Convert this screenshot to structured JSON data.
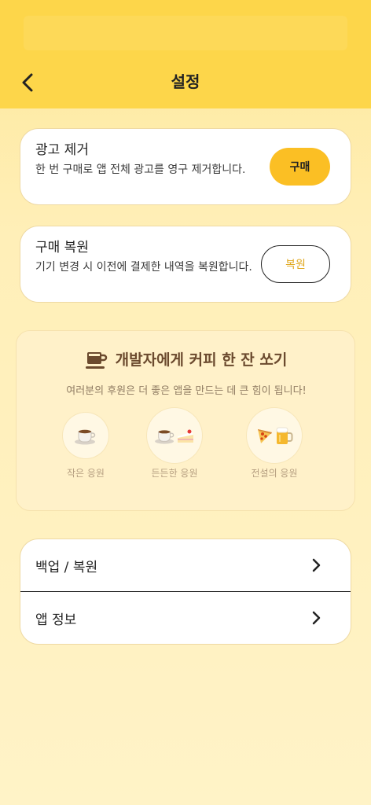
{
  "header": {
    "title": "설정",
    "back_icon": "chevron-left-icon"
  },
  "remove_ads": {
    "title": "광고 제거",
    "description": "한 번 구매로 앱 전체 광고를 영구 제거합니다.",
    "button_label": "구매"
  },
  "restore_purchase": {
    "title": "구매 복원",
    "description": "기기 변경 시 이전에 결제한 내역을 복원합니다.",
    "button_label": "복원"
  },
  "coffee": {
    "title": "개발자에게 커피 한 잔 쏘기",
    "subtitle": "여러분의 후원은 더 좋은 앱을 만드는 데 큰 힘이 됩니다!",
    "icon": "coffee-cup-icon",
    "tiers": [
      {
        "label": "작은 응원",
        "icons": [
          "coffee-icon"
        ]
      },
      {
        "label": "든든한 응원",
        "icons": [
          "coffee-icon",
          "cake-icon"
        ]
      },
      {
        "label": "전설의 응원",
        "icons": [
          "pizza-icon",
          "beer-icon"
        ]
      }
    ]
  },
  "menu": {
    "items": [
      {
        "label": "백업 / 복원",
        "icon": "chevron-right-icon"
      },
      {
        "label": "앱 정보",
        "icon": "chevron-right-icon"
      }
    ]
  },
  "colors": {
    "header_bg": "#FDD64A",
    "accent": "#FBBF24",
    "restore_text": "#E0A820",
    "coffee_title": "#6B4A2E"
  }
}
